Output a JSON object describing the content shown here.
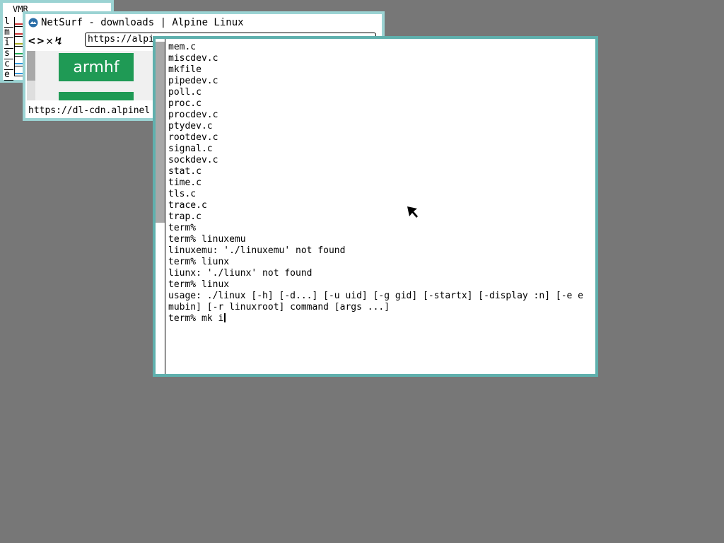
{
  "stats": {
    "title": "VMR",
    "labels": [
      "l",
      "m",
      "i",
      "s",
      "c",
      "e"
    ],
    "colors": [
      "#cc3333",
      "#cc3333",
      "#aaaa22",
      "#22aa55",
      "#3399dd",
      "#3399dd"
    ]
  },
  "netsurf": {
    "title": "NetSurf - downloads | Alpine Linux",
    "nav": {
      "back": "<",
      "forward": ">",
      "stop": "✕",
      "reload": "↯"
    },
    "url": "https://alpi",
    "content": {
      "button_label": "armhf"
    },
    "status": "https://dl-cdn.alpinel"
  },
  "terminal": {
    "lines": [
      "mem.c",
      "miscdev.c",
      "mkfile",
      "pipedev.c",
      "poll.c",
      "proc.c",
      "procdev.c",
      "ptydev.c",
      "rootdev.c",
      "signal.c",
      "sockdev.c",
      "stat.c",
      "time.c",
      "tls.c",
      "trace.c",
      "trap.c",
      "term%",
      "term% linuxemu",
      "linuxemu: './linuxemu' not found",
      "term% liunx",
      "liunx: './liunx' not found",
      "term% linux",
      "usage: ./linux [-h] [-d...] [-u uid] [-g gid] [-startx] [-display :n] [-e e",
      "mubin] [-r linuxroot] command [args ...]"
    ],
    "prompt_line": "term% mk i"
  }
}
